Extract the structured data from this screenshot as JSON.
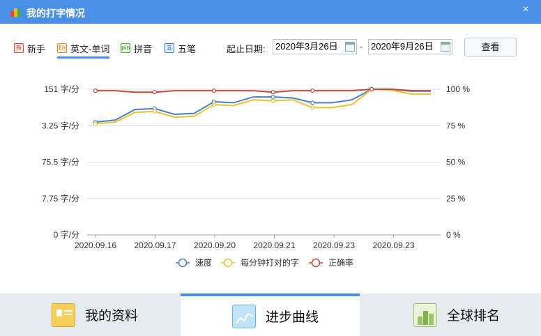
{
  "window": {
    "title": "我的打字情况",
    "close_glyph": "×"
  },
  "modes": [
    {
      "label": "新手",
      "icon": "新",
      "color": "#c94a3a"
    },
    {
      "label": "英文-单词",
      "icon": "En",
      "color": "#d08a2a",
      "active": true
    },
    {
      "label": "拼音",
      "icon": "pin",
      "color": "#4aa23a"
    },
    {
      "label": "五笔",
      "icon": "五",
      "color": "#3a7ac9"
    }
  ],
  "date": {
    "label": "起止日期:",
    "start": "2020年3月26日",
    "separator": "-",
    "end": "2020年9月26日"
  },
  "view_button": "查看",
  "chart_data": {
    "type": "line",
    "categories": [
      "2020.09.16",
      "",
      "2020.09.17",
      "",
      "2020.09.20",
      "",
      "2020.09.21",
      "",
      "2020.09.23",
      "",
      "2020.09.23",
      "",
      ""
    ],
    "x_tick_labels": [
      "2020.09.16",
      "2020.09.17",
      "2020.09.20",
      "2020.09.21",
      "2020.09.23",
      "2020.09.23"
    ],
    "y_left_ticks": [
      "0 字/分",
      "7.75 字/分",
      "75.5 字/分",
      "3.25 字/分",
      "151 字/分"
    ],
    "y_right_ticks": [
      "0 %",
      "25 %",
      "50 %",
      "75 %",
      "100 %"
    ],
    "ylim_left": [
      0,
      151
    ],
    "ylim_right": [
      0,
      100
    ],
    "series": [
      {
        "name": "速度",
        "color": "#4a7fc1",
        "axis": "left",
        "values": [
          117,
          119,
          130,
          131,
          125,
          126,
          138,
          137,
          143,
          143,
          142,
          137,
          137,
          140,
          151,
          151,
          149,
          149
        ]
      },
      {
        "name": "每分钟打对的字",
        "color": "#e8c22f",
        "axis": "left",
        "values": [
          115,
          117,
          127,
          128,
          122,
          123,
          135,
          134,
          140,
          139,
          140,
          132,
          132,
          135,
          151,
          150,
          146,
          146
        ]
      },
      {
        "name": "正确率",
        "color": "#c0473b",
        "axis": "right",
        "values": [
          99,
          99,
          98,
          98,
          99,
          99,
          99,
          99,
          99,
          98,
          99,
          99,
          99,
          99,
          100,
          100,
          99,
          99
        ]
      }
    ],
    "legend": "bottom",
    "grid": true
  },
  "tabs": [
    {
      "label": "我的资料",
      "icon": "profile-card-icon"
    },
    {
      "label": "进步曲线",
      "icon": "progress-chart-icon",
      "active": true
    },
    {
      "label": "全球排名",
      "icon": "ranking-icon"
    }
  ]
}
